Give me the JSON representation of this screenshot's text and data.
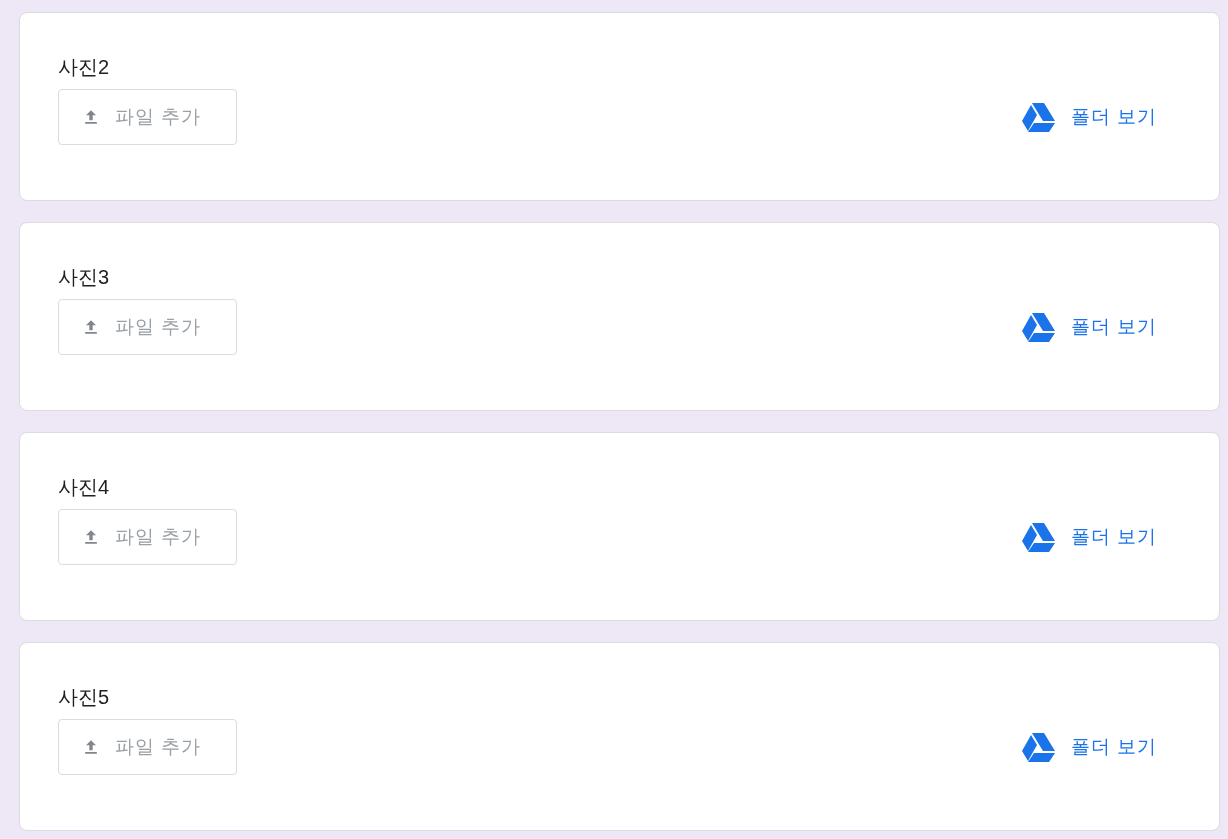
{
  "questions": [
    {
      "title": "사진2",
      "upload_label": "파일 추가",
      "folder_link": "폴더 보기"
    },
    {
      "title": "사진3",
      "upload_label": "파일 추가",
      "folder_link": "폴더 보기"
    },
    {
      "title": "사진4",
      "upload_label": "파일 추가",
      "folder_link": "폴더 보기"
    },
    {
      "title": "사진5",
      "upload_label": "파일 추가",
      "folder_link": "폴더 보기"
    }
  ]
}
